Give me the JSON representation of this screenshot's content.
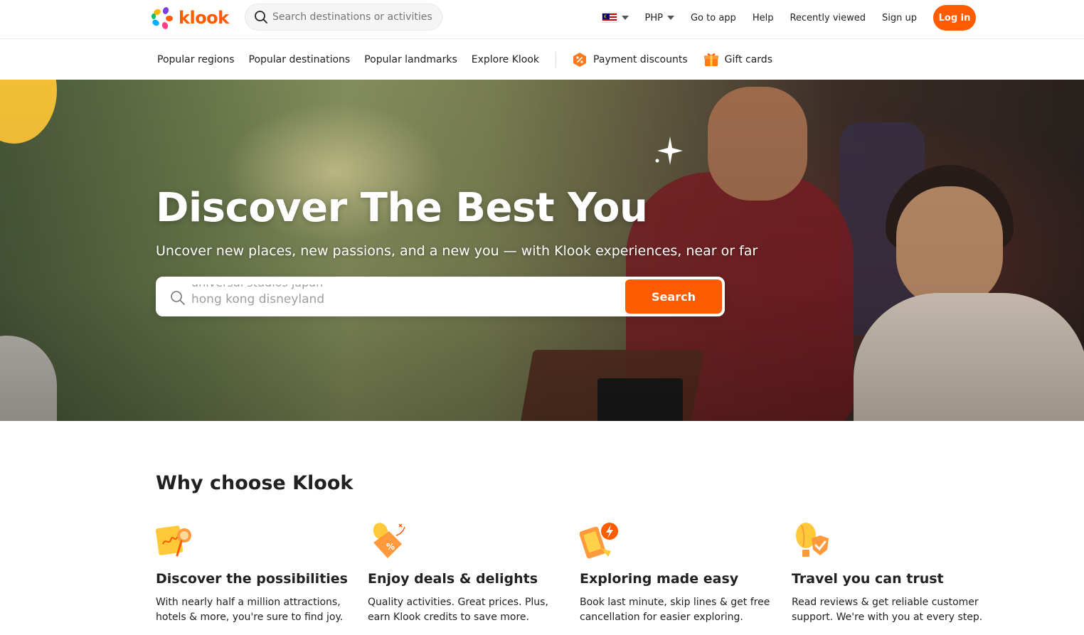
{
  "header": {
    "brand": "klook",
    "search_placeholder": "Search destinations or activities",
    "currency": "PHP",
    "links": [
      "Go to app",
      "Help",
      "Recently viewed",
      "Sign up"
    ],
    "login_label": "Log in"
  },
  "nav": {
    "links": [
      "Popular regions",
      "Popular destinations",
      "Popular landmarks",
      "Explore Klook"
    ],
    "payment_discounts": "Payment discounts",
    "gift_cards": "Gift cards"
  },
  "hero": {
    "title": "Discover The Best You",
    "subtitle": "Uncover new places, new passions, and a new you — with Klook experiences, near or far",
    "search_placeholder_prev": "universal studios japan",
    "search_placeholder": "hong kong disneyland",
    "search_button": "Search"
  },
  "why": {
    "title": "Why choose Klook",
    "features": [
      {
        "icon": "map-search-icon",
        "title": "Discover the possibilities",
        "text": "With nearly half a million attractions, hotels & more, you're sure to find joy."
      },
      {
        "icon": "discount-tag-icon",
        "title": "Enjoy deals & delights",
        "text": "Quality activities. Great prices. Plus, earn Klook credits to save more."
      },
      {
        "icon": "phone-lightning-icon",
        "title": "Exploring made easy",
        "text": "Book last minute, skip lines & get free cancellation for easier exploring."
      },
      {
        "icon": "balloon-shield-icon",
        "title": "Travel you can trust",
        "text": "Read reviews & get reliable customer support. We're with you at every step."
      }
    ]
  },
  "colors": {
    "brand": "#ff5b00",
    "text": "#212121"
  }
}
